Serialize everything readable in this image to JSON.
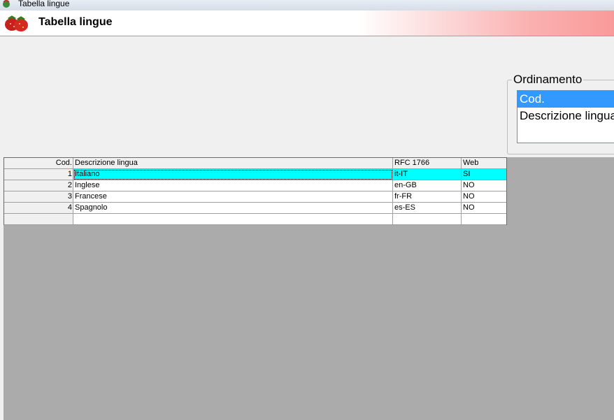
{
  "window": {
    "title": "Tabella lingue",
    "icon": "app-icon"
  },
  "header": {
    "title": "Tabella lingue",
    "icon": "strawberry-logo-icon"
  },
  "sort": {
    "legend": "Ordinamento",
    "options": [
      "Cod.",
      "Descrizione lingua"
    ],
    "selected": "Cod."
  },
  "table": {
    "columns": [
      "Cod.",
      "Descrizione lingua",
      "RFC 1766",
      "Web"
    ],
    "rows": [
      {
        "cod": "1",
        "desc": "Italiano",
        "rfc": "it-IT",
        "web": "SI"
      },
      {
        "cod": "2",
        "desc": "Inglese",
        "rfc": "en-GB",
        "web": "NO"
      },
      {
        "cod": "3",
        "desc": "Francese",
        "rfc": "fr-FR",
        "web": "NO"
      },
      {
        "cod": "4",
        "desc": "Spagnolo",
        "rfc": "es-ES",
        "web": "NO"
      }
    ],
    "selected_row": 1
  },
  "colors": {
    "selection": "#3399ff",
    "active_row": "#00ffff",
    "grid_background": "#ababab"
  }
}
